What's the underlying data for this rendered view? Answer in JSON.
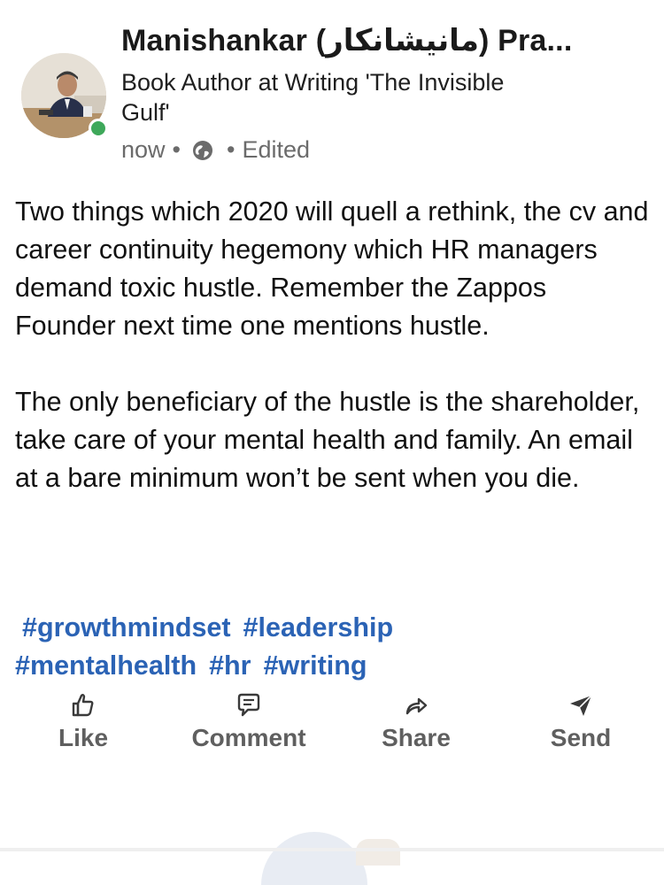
{
  "author": {
    "name": "Manishankar (مانیشانکار) Pra...",
    "headline": "Book Author at Writing 'The Invisible Gulf'",
    "time": "now",
    "edited": "Edited",
    "avatar_icon": "profile-photo",
    "online_color": "#3ea85a"
  },
  "post": {
    "paragraphs": [
      "Two things which 2020 will quell a rethink, the cv and career continuity hegemony which HR managers demand toxic hustle. Remember the Zappos Founder next time one mentions hustle.",
      "The only beneficiary of the hustle is the shareholder, take care of your mental health and family. An email at a bare minimum won’t be sent when you die."
    ],
    "hashtags": [
      "#growthmindset",
      "#leadership",
      "#mentalhealth",
      "#hr",
      "#writing"
    ],
    "hashtag_color": "#2b63b5"
  },
  "actions": {
    "like": "Like",
    "comment": "Comment",
    "share": "Share",
    "send": "Send"
  }
}
